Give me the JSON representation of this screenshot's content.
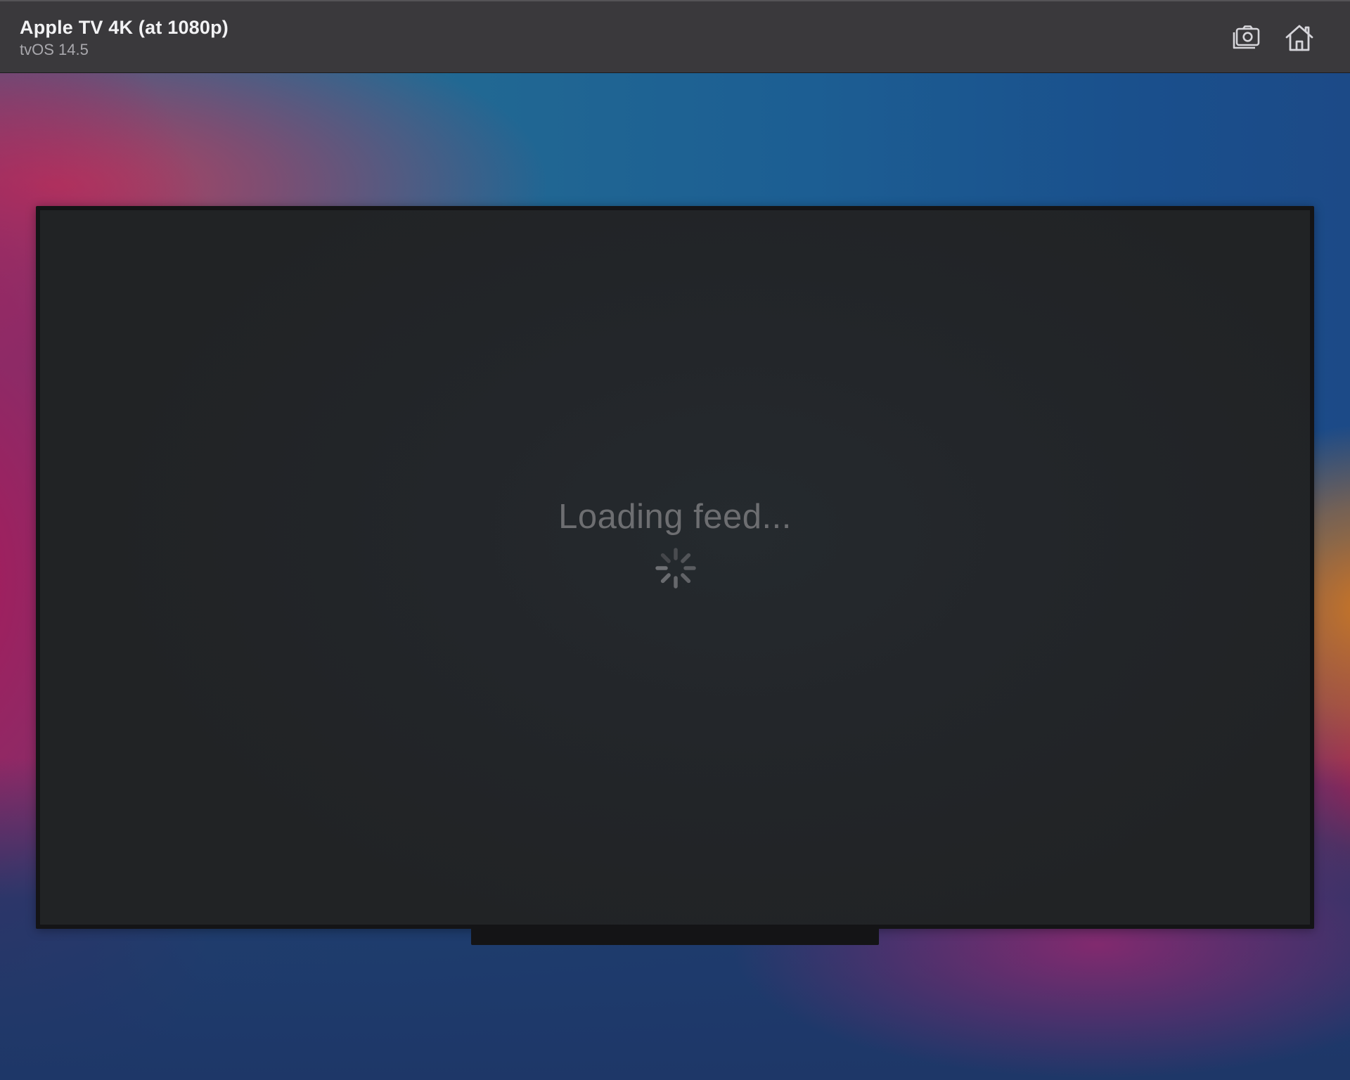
{
  "titlebar": {
    "device_name": "Apple TV 4K (at 1080p)",
    "os_version": "tvOS 14.5",
    "screenshot_icon": "camera-screenshot-icon",
    "home_icon": "home-icon"
  },
  "screen": {
    "status_text": "Loading feed...",
    "spinner_icon": "activity-spinner-icon"
  },
  "colors": {
    "titlebar_bg": "#3a393c",
    "screen_bg": "#232629",
    "loading_text": "#6d6e71"
  }
}
